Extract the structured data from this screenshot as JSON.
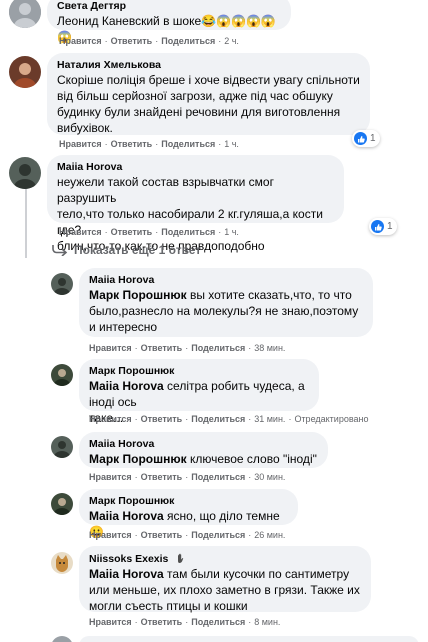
{
  "colors": {
    "bubble": "#f0f2f5",
    "like": "#1877f2",
    "meta": "#65676b"
  },
  "actions": {
    "like": "Нравится",
    "reply": "Ответить",
    "share": "Поделиться",
    "dot": "·"
  },
  "comments": [
    {
      "author": "Света Дегтяр",
      "text": "Леонид Каневский в шоке😂😱😱😱😱😱",
      "time": "2 ч.",
      "avatar_icon": "profile-photo"
    },
    {
      "author": "Наталия Хмелькова",
      "text": "Скоріше поліція бреше і хоче відвести увагу спільноти\nвід більш серйозної загрози, адже під час обшуку\nбудинку були знайдені речовини для виготовлення\nвибухівок.",
      "time": "1 ч.",
      "reactions": "1",
      "avatar_icon": "profile-photo"
    },
    {
      "author": "Maiia Horova",
      "text": "неужели такой состав взрывчатки смог разрушить\nтело,что только насобирали 2 кг.гуляша,а кости где?\nблин,что-то как-то не правдоподобно",
      "time": "1 ч.",
      "reactions": "1",
      "avatar_icon": "profile-photo"
    }
  ],
  "show_more": "Показать ещё 1 ответ",
  "replies": [
    {
      "author": "Maiia Horova",
      "mention": "Марк Порошнюк",
      "text": " вы хотите сказать,что, то что\nбыло,разнесло на молекулы?я не знаю,поэтому\nи интересно",
      "time": "38 мин.",
      "avatar_icon": "profile-photo"
    },
    {
      "author": "Марк Порошнюк",
      "mention": "Maiia Horova",
      "text": " селітра робить чудеса, а іноді ось\nтаке...",
      "time": "31 мин.",
      "extra": "Отредактировано",
      "avatar_icon": "profile-photo"
    },
    {
      "author": "Maiia Horova",
      "mention": "Марк Порошнюк",
      "text": " ключевое слово \"іноді\"",
      "time": "30 мин.",
      "avatar_icon": "profile-photo"
    },
    {
      "author": "Марк Порошнюк",
      "mention": "Maiia Horova",
      "text": " ясно, що діло темне😀",
      "time": "26 мин.",
      "avatar_icon": "profile-photo"
    },
    {
      "author": "Niissoks Exexis",
      "badge_icon": "waving-hand-icon",
      "mention": "Maiia Horova",
      "text": " там были кусочки по сантиметру\nили меньше, их плохо заметно в грязи. Также их\nмогли съесть птицы и кошки",
      "time": "8 мин.",
      "avatar_icon": "cat-photo"
    }
  ]
}
